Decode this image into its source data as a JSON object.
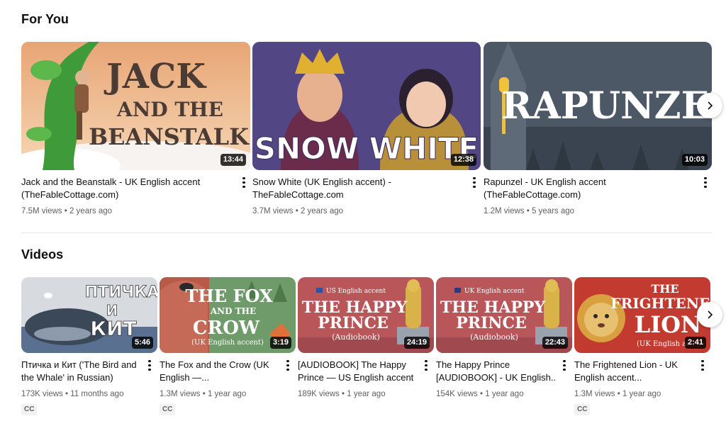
{
  "sections": {
    "for_you": {
      "title": "For You"
    },
    "videos": {
      "title": "Videos"
    }
  },
  "for_you_cards": [
    {
      "thumb_text": [
        "JACK",
        "AND THE",
        "BEANSTALK"
      ],
      "duration": "13:44",
      "title_lines": [
        "Jack and the Beanstalk - UK English accent",
        "(TheFableCottage.com)"
      ],
      "views": "7.5M views",
      "age": "2 years ago"
    },
    {
      "thumb_text": [
        "SNOW WHITE"
      ],
      "duration": "12:38",
      "title_lines": [
        "Snow White (UK English accent) -",
        "TheFableCottage.com"
      ],
      "views": "3.7M views",
      "age": "2 years ago"
    },
    {
      "thumb_text": [
        "RAPUNZEL"
      ],
      "duration": "10:03",
      "title_lines": [
        "Rapunzel - UK English accent",
        "(TheFableCottage.com)"
      ],
      "views": "1.2M views",
      "age": "5 years ago"
    }
  ],
  "video_cards": [
    {
      "thumb_text": [
        "ПТИЧКА",
        "И",
        "КИТ"
      ],
      "duration": "5:46",
      "title_lines": [
        "Птичка и Кит ('The Bird and",
        "the Whale' in Russian)"
      ],
      "views": "173K views",
      "age": "11 months ago",
      "badge": "CC"
    },
    {
      "thumb_text": [
        "THE FOX",
        "AND THE",
        "CROW",
        "(UK English accent)"
      ],
      "duration": "3:19",
      "title_lines": [
        "The Fox and the Crow (UK",
        "English —..."
      ],
      "views": "1.3M views",
      "age": "1 year ago",
      "badge": "CC"
    },
    {
      "thumb_text": [
        "US English accent",
        "THE HAPPY",
        "PRINCE",
        "(Audiobook)"
      ],
      "duration": "24:19",
      "title_lines": [
        "[AUDIOBOOK] The Happy",
        "Prince — US English accent"
      ],
      "views": "189K views",
      "age": "1 year ago",
      "badge": ""
    },
    {
      "thumb_text": [
        "UK English accent",
        "THE HAPPY",
        "PRINCE",
        "(Audiobook)"
      ],
      "duration": "22:43",
      "title_lines": [
        "The Happy Prince",
        "[AUDIOBOOK] - UK English..."
      ],
      "views": "154K views",
      "age": "1 year ago",
      "badge": ""
    },
    {
      "thumb_text": [
        "THE",
        "FRIGHTENED",
        "LION",
        "(UK English ac"
      ],
      "duration": "2:41",
      "title_lines": [
        "The Frightened Lion - UK",
        "English accent..."
      ],
      "views": "1.3M views",
      "age": "1 year ago",
      "badge": "CC"
    }
  ],
  "separator": "•",
  "colors": {
    "accent_text": "#0f0f0f",
    "secondary_text": "#606060",
    "divider": "#e5e5e5"
  },
  "icons": {
    "more": "kebab-icon",
    "next": "chevron-right-icon"
  }
}
